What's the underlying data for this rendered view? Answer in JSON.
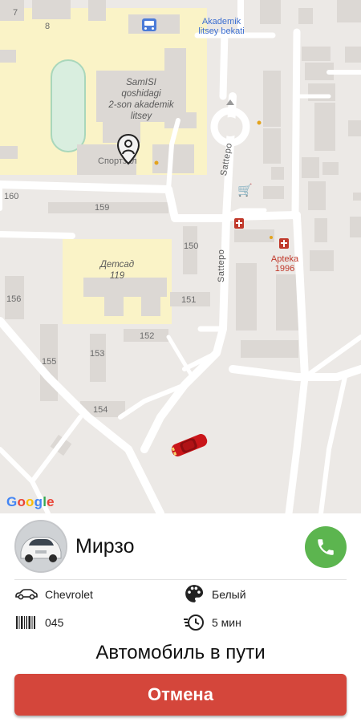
{
  "map": {
    "labels": {
      "house_7": "7",
      "house_8": "8",
      "house_160": "160",
      "house_159": "159",
      "house_150": "150",
      "house_151": "151",
      "house_152": "152",
      "house_153": "153",
      "house_154": "154",
      "house_155": "155",
      "house_156": "156",
      "school": "SamISI\nqoshidagi\n2-son akademik\nlitsey",
      "sport_hall": "Спортзал",
      "kindergarten": "Детсад\n119",
      "bus_stop": "Akademik\nlitsey bekati",
      "pharmacy": "Apteka\n1996",
      "street_1": "Sattepo",
      "street_2": "Sattepo"
    },
    "attribution": [
      "G",
      "o",
      "o",
      "g",
      "l",
      "e"
    ]
  },
  "colors": {
    "accent_green": "#5cb54f",
    "cancel_red": "#d4463b",
    "car_red": "#d01c1c"
  },
  "driver": {
    "name": "Мирзо",
    "car_model": "Chevrolet",
    "car_color": "Белый",
    "plate": "045",
    "eta": "5 мин"
  },
  "status_text": "Автомобиль в пути",
  "cancel_label": "Отмена",
  "icons": {
    "call": "phone-icon",
    "car": "car-icon",
    "palette": "palette-icon",
    "plate": "barcode-icon",
    "eta": "clock-icon",
    "location": "location-pin-icon"
  }
}
